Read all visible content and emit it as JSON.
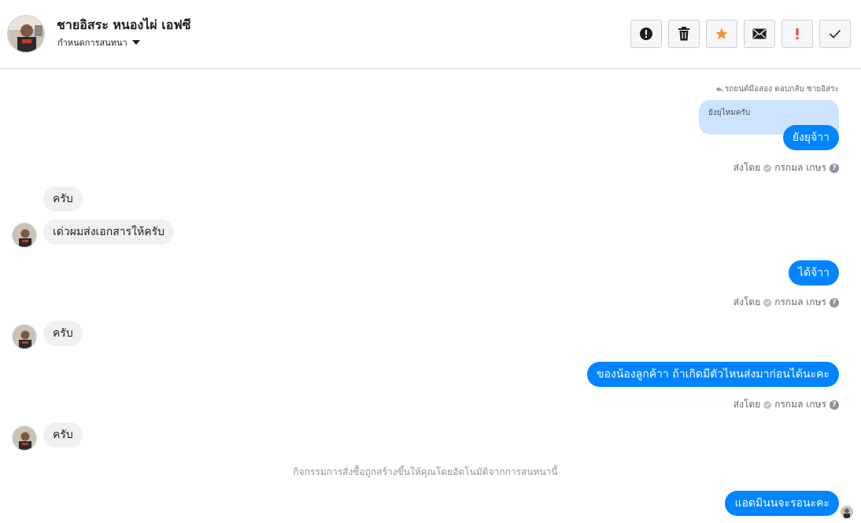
{
  "header": {
    "name": "ชายอิสระ หนองไผ่ เอฟซี",
    "subtitle": "กำหนดการสนทนา",
    "actions": [
      {
        "icon": "alert-circle-icon"
      },
      {
        "icon": "trash-icon"
      },
      {
        "icon": "star-icon",
        "color": "#f7923a"
      },
      {
        "icon": "envelope-icon"
      },
      {
        "icon": "exclamation-icon",
        "color": "#fa3e3e"
      },
      {
        "icon": "checkmark-icon"
      }
    ]
  },
  "thread": {
    "reply_note": "รถยนต์มือสอง ตอบกลับ ชายอิสระ",
    "quoted_text": "ยังยุไหมครับ",
    "messages": [
      {
        "dir": "out",
        "text": "ยังยุจ้าา",
        "sent_by_prefix": "ส่งโดย",
        "sent_by_name": "กรกมล เกษร"
      },
      {
        "dir": "in",
        "text": "ครับ"
      },
      {
        "dir": "in",
        "text": "เด่วผมส่งเอกสารให้ครับ"
      },
      {
        "dir": "out",
        "text": "ได้จ้าา",
        "sent_by_prefix": "ส่งโดย",
        "sent_by_name": "กรกมล เกษร"
      },
      {
        "dir": "in",
        "text": "ครับ"
      },
      {
        "dir": "out",
        "text": "ของน้องลูกค้าา ถ้าเกิดมีตัวไหนส่งมาก่อนได้นะคะ",
        "sent_by_prefix": "ส่งโดย",
        "sent_by_name": "กรกมล เกษร"
      },
      {
        "dir": "in",
        "text": "ครับ"
      },
      {
        "dir": "out",
        "text": "แอดมินนจะรอนะคะ"
      }
    ],
    "system_note": "กิจกรรมการสั่งซื้อถูกสร้างขึ้นให้คุณโดยอัตโนมัติจากการสนทนานี้"
  },
  "colors": {
    "outgoing_bubble": "#0084ff",
    "incoming_bubble": "#f1f0f0",
    "quoted_bubble": "#cce4ff"
  }
}
